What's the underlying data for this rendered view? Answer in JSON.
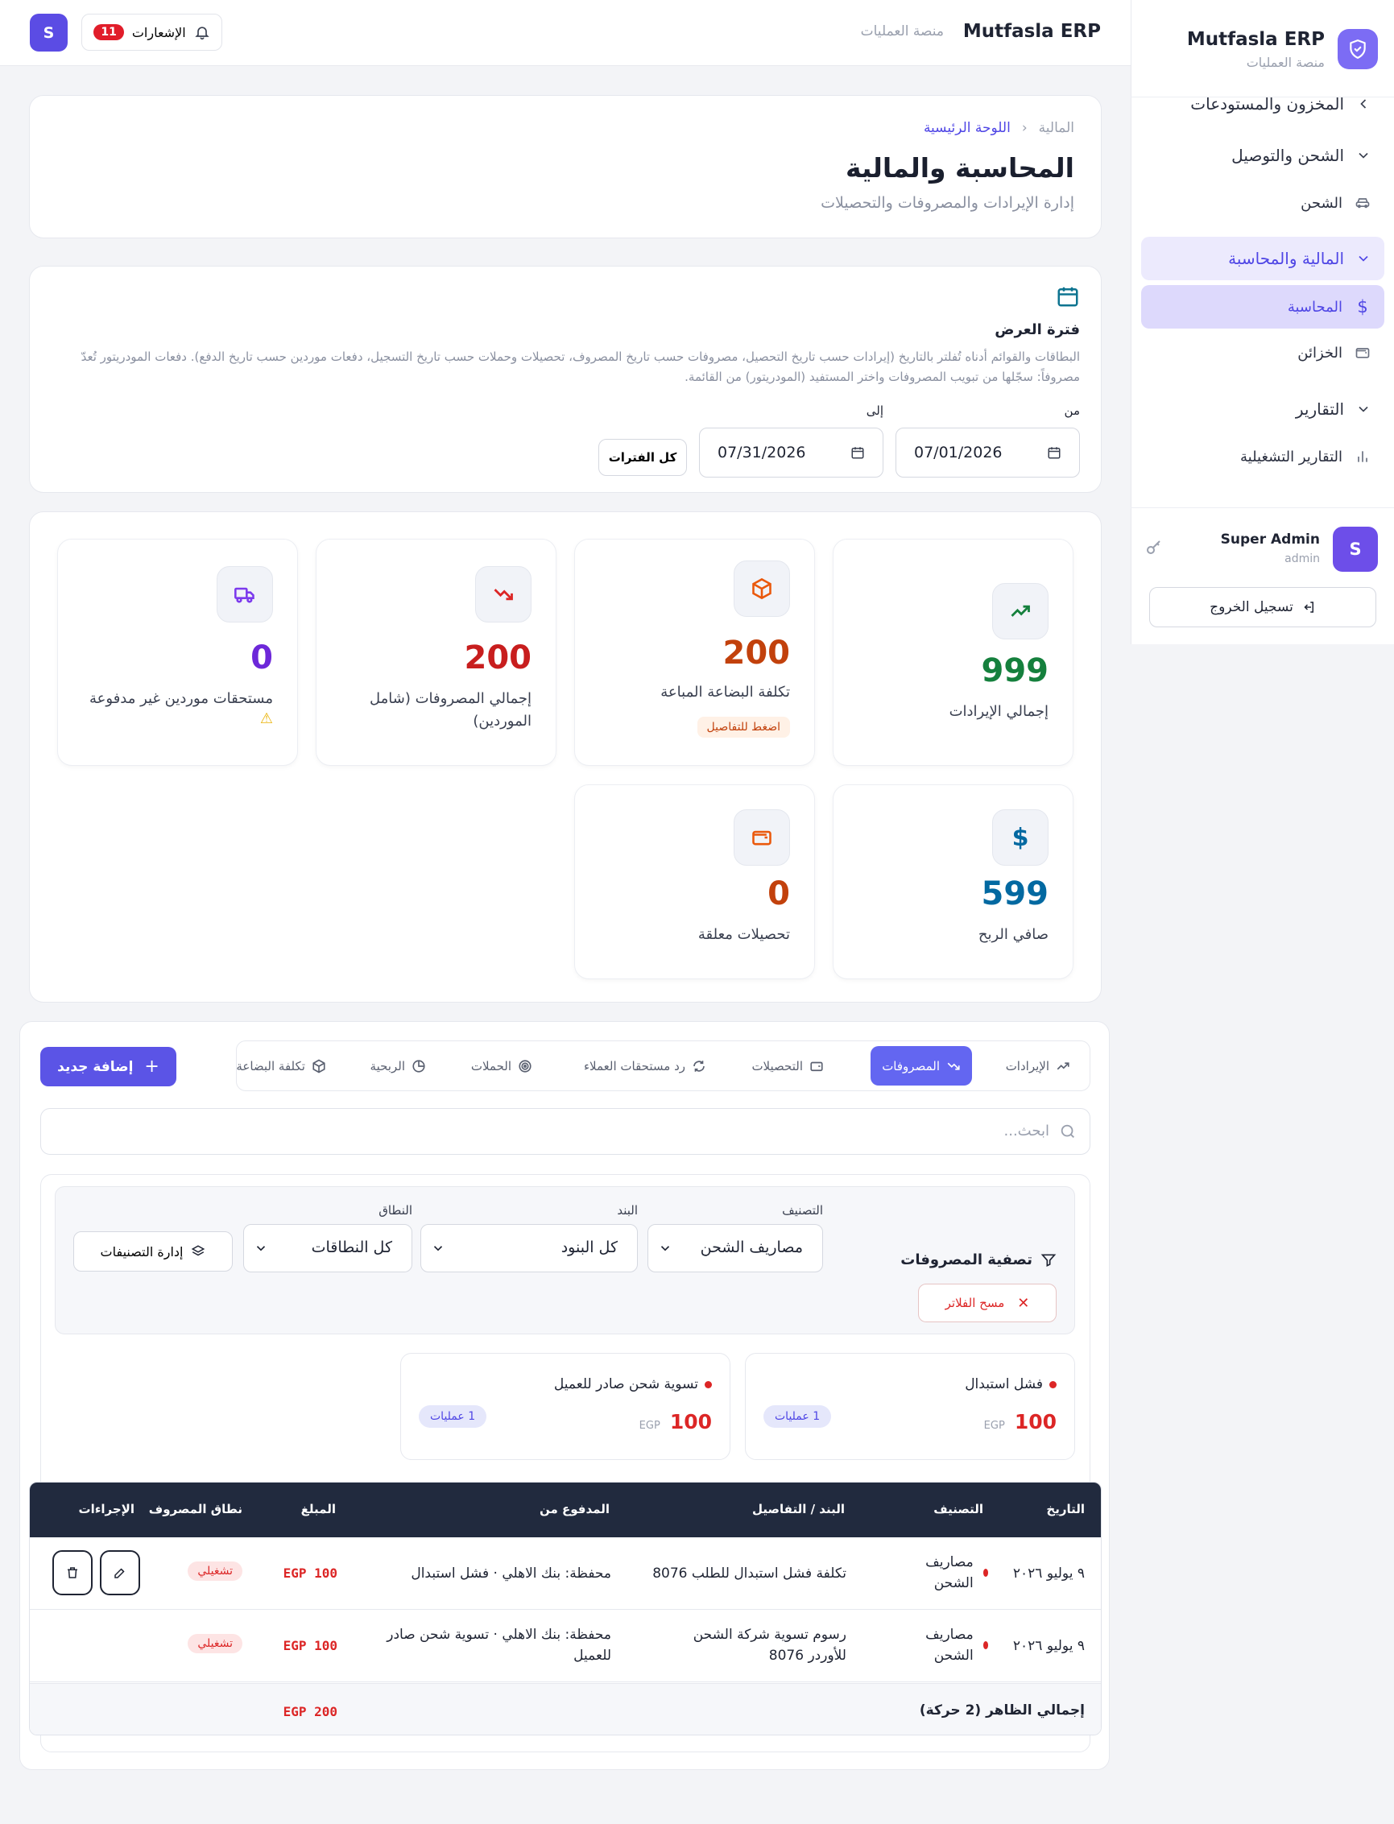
{
  "brand": {
    "name": "Mutfasla ERP",
    "subtitle": "منصة العمليات"
  },
  "topbar": {
    "notifications_label": "الإشعارات",
    "notifications_count": "11",
    "avatar_letter": "S"
  },
  "sidebar": {
    "items": [
      {
        "label": "المخزون والمستودعات",
        "type": "group"
      },
      {
        "label": "الشحن والتوصيل",
        "type": "group"
      },
      {
        "label": "الشحن",
        "type": "child"
      },
      {
        "label": "المالية والمحاسبة",
        "type": "group"
      },
      {
        "label": "المحاسبة",
        "type": "child"
      },
      {
        "label": "الخزائن",
        "type": "child"
      },
      {
        "label": "التقارير",
        "type": "group"
      },
      {
        "label": "التقارير التشغيلية",
        "type": "child"
      }
    ],
    "user": {
      "avatar_letter": "S",
      "name": "Super Admin",
      "role": "admin"
    },
    "logout_label": "تسجيل الخروج"
  },
  "header": {
    "breadcrumb": [
      "المالية",
      "اللوحة الرئيسية"
    ],
    "title": "المحاسبة والمالية",
    "subtitle": "إدارة الإيرادات والمصروفات والتحصيلات"
  },
  "period": {
    "title": "فترة العرض",
    "description": "البطاقات والقوائم أدناه تُفلتر بالتاريخ (إيرادات حسب تاريخ التحصيل، مصروفات حسب تاريخ المصروف، تحصيلات وحملات حسب تاريخ التسجيل، دفعات موردين حسب تاريخ الدفع). دفعات المودريتور تُعدّ مصروفاً: سجّلها من تبويب المصروفات واختر المستفيد (المودريتور) من القائمة.",
    "from_label": "من",
    "to_label": "إلى",
    "from_value": "07/01/2026",
    "to_value": "07/31/2026",
    "all_periods_label": "كل الفترات"
  },
  "stats": [
    {
      "label": "إجمالي الإيرادات",
      "value": "999",
      "color": "#15803d",
      "icon": "trending-up-icon"
    },
    {
      "label": "تكلفة البضاعة المباعة",
      "value": "200",
      "color": "#c2410c",
      "icon": "box-icon",
      "pill": "اضغط للتفاصيل"
    },
    {
      "label": "إجمالي المصروفات (شامل الموردين)",
      "value": "200",
      "color": "#c81e1e",
      "icon": "trending-down-icon"
    },
    {
      "label": "مستحقات موردين غير مدفوعة",
      "value": "0",
      "color": "#6d28d9",
      "icon": "truck-icon",
      "warning": "⚠"
    },
    {
      "label": "صافي الربح",
      "value": "599",
      "color": "#0369a1",
      "icon": "dollar-icon"
    },
    {
      "label": "تحصيلات معلقة",
      "value": "0",
      "color": "#c2410c",
      "icon": "wallet-icon"
    }
  ],
  "tabs": [
    {
      "label": "الإيرادات",
      "icon": "trending-up-icon"
    },
    {
      "label": "المصروفات",
      "icon": "trending-down-icon",
      "active": true
    },
    {
      "label": "التحصيلات",
      "icon": "wallet-icon"
    },
    {
      "label": "رد مستحقات العملاء",
      "icon": "refresh-icon"
    },
    {
      "label": "الحملات",
      "icon": "target-icon"
    },
    {
      "label": "الربحية",
      "icon": "pie-icon"
    },
    {
      "label": "تكلفة البضاعة",
      "icon": "box-icon"
    }
  ],
  "add_new_label": "إضافة جديد",
  "search": {
    "placeholder": "ابحث..."
  },
  "filter": {
    "title": "تصفية المصروفات",
    "clear_label": "مسح الفلاتر",
    "category_label": "التصنيف",
    "category_value": "مصاريف الشحن",
    "item_label": "البند",
    "item_value": "كل البنود",
    "scope_label": "النطاق",
    "scope_value": "كل النطاقات",
    "manage_label": "إدارة التصنيفات"
  },
  "summary_cards": [
    {
      "name": "فشل استبدال",
      "amount": "100",
      "currency": "EGP",
      "ops": "1 عمليات"
    },
    {
      "name": "تسوية شحن صادر للعميل",
      "amount": "100",
      "currency": "EGP",
      "ops": "1 عمليات"
    }
  ],
  "table": {
    "headers": [
      "التاريخ",
      "التصنيف",
      "البند / التفاصيل",
      "المدفوع من",
      "المبلغ",
      "نطاق المصروف",
      "الإجراءات"
    ],
    "rows": [
      {
        "date": "٩ يوليو ٢٠٢٦",
        "category": "مصاريف الشحن",
        "details": "تكلفة فشل استبدال للطلب 8076",
        "paid_from": "محفظة: بنك الاهلي · فشل استبدال",
        "amount": "EGP 100",
        "scope": "تشغيلي",
        "actions": true
      },
      {
        "date": "٩ يوليو ٢٠٢٦",
        "category": "مصاريف الشحن",
        "details": "رسوم تسوية شركة الشحن للأوردر 8076",
        "paid_from": "محفظة: بنك الاهلي · تسوية شحن صادر للعميل",
        "amount": "EGP 100",
        "scope": "تشغيلي",
        "actions": false
      }
    ],
    "footer_label": "إجمالي الظاهر (2 حركة)",
    "footer_total": "EGP 200"
  }
}
